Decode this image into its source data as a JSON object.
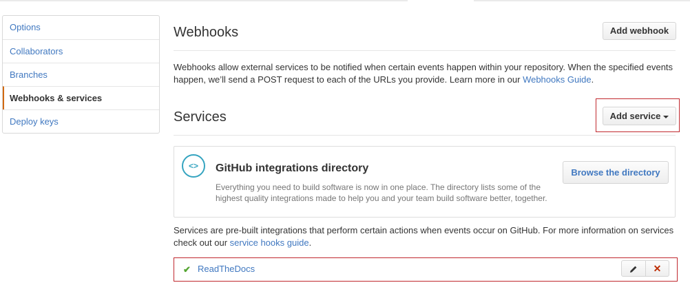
{
  "sidebar": {
    "items": [
      {
        "label": "Options"
      },
      {
        "label": "Collaborators"
      },
      {
        "label": "Branches"
      },
      {
        "label": "Webhooks & services"
      },
      {
        "label": "Deploy keys"
      }
    ],
    "selected": "Webhooks & services"
  },
  "webhooks": {
    "title": "Webhooks",
    "add_label": "Add webhook",
    "description": "Webhooks allow external services to be notified when certain events happen within your repository. When the specified events happen, we’ll send a POST request to each of the URLs you provide. Learn more in our ",
    "guide_link": "Webhooks Guide",
    "guide_end": "."
  },
  "services": {
    "title": "Services",
    "add_label": "Add service",
    "description": "Services are pre-built integrations that perform certain actions when events occur on GitHub. For more information on services check out our ",
    "guide_link": "service hooks guide",
    "guide_end": ".",
    "items": [
      {
        "name": "ReadTheDocs",
        "status_icon": "check-icon",
        "edit_icon": "pencil-icon",
        "delete_icon": "x-icon"
      }
    ]
  },
  "integrations": {
    "icon": "code-icon",
    "title": "GitHub integrations directory",
    "description": "Everything you need to build software is now in one place. The directory lists some of the highest quality integrations made to help you and your team build software better, together.",
    "browse_label": "Browse the directory"
  },
  "colors": {
    "link": "#4078c0",
    "selected_accent": "#d26911",
    "highlight_box": "#c0272d",
    "check": "#55a532",
    "delete": "#bd2c00",
    "integration_icon": "#35a4c0"
  }
}
